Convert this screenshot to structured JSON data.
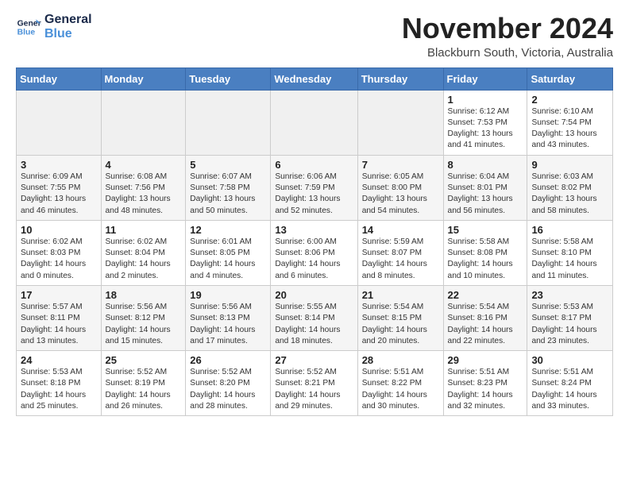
{
  "header": {
    "logo_line1": "General",
    "logo_line2": "Blue",
    "month": "November 2024",
    "location": "Blackburn South, Victoria, Australia"
  },
  "weekdays": [
    "Sunday",
    "Monday",
    "Tuesday",
    "Wednesday",
    "Thursday",
    "Friday",
    "Saturday"
  ],
  "weeks": [
    [
      {
        "day": "",
        "info": ""
      },
      {
        "day": "",
        "info": ""
      },
      {
        "day": "",
        "info": ""
      },
      {
        "day": "",
        "info": ""
      },
      {
        "day": "",
        "info": ""
      },
      {
        "day": "1",
        "info": "Sunrise: 6:12 AM\nSunset: 7:53 PM\nDaylight: 13 hours\nand 41 minutes."
      },
      {
        "day": "2",
        "info": "Sunrise: 6:10 AM\nSunset: 7:54 PM\nDaylight: 13 hours\nand 43 minutes."
      }
    ],
    [
      {
        "day": "3",
        "info": "Sunrise: 6:09 AM\nSunset: 7:55 PM\nDaylight: 13 hours\nand 46 minutes."
      },
      {
        "day": "4",
        "info": "Sunrise: 6:08 AM\nSunset: 7:56 PM\nDaylight: 13 hours\nand 48 minutes."
      },
      {
        "day": "5",
        "info": "Sunrise: 6:07 AM\nSunset: 7:58 PM\nDaylight: 13 hours\nand 50 minutes."
      },
      {
        "day": "6",
        "info": "Sunrise: 6:06 AM\nSunset: 7:59 PM\nDaylight: 13 hours\nand 52 minutes."
      },
      {
        "day": "7",
        "info": "Sunrise: 6:05 AM\nSunset: 8:00 PM\nDaylight: 13 hours\nand 54 minutes."
      },
      {
        "day": "8",
        "info": "Sunrise: 6:04 AM\nSunset: 8:01 PM\nDaylight: 13 hours\nand 56 minutes."
      },
      {
        "day": "9",
        "info": "Sunrise: 6:03 AM\nSunset: 8:02 PM\nDaylight: 13 hours\nand 58 minutes."
      }
    ],
    [
      {
        "day": "10",
        "info": "Sunrise: 6:02 AM\nSunset: 8:03 PM\nDaylight: 14 hours\nand 0 minutes."
      },
      {
        "day": "11",
        "info": "Sunrise: 6:02 AM\nSunset: 8:04 PM\nDaylight: 14 hours\nand 2 minutes."
      },
      {
        "day": "12",
        "info": "Sunrise: 6:01 AM\nSunset: 8:05 PM\nDaylight: 14 hours\nand 4 minutes."
      },
      {
        "day": "13",
        "info": "Sunrise: 6:00 AM\nSunset: 8:06 PM\nDaylight: 14 hours\nand 6 minutes."
      },
      {
        "day": "14",
        "info": "Sunrise: 5:59 AM\nSunset: 8:07 PM\nDaylight: 14 hours\nand 8 minutes."
      },
      {
        "day": "15",
        "info": "Sunrise: 5:58 AM\nSunset: 8:08 PM\nDaylight: 14 hours\nand 10 minutes."
      },
      {
        "day": "16",
        "info": "Sunrise: 5:58 AM\nSunset: 8:10 PM\nDaylight: 14 hours\nand 11 minutes."
      }
    ],
    [
      {
        "day": "17",
        "info": "Sunrise: 5:57 AM\nSunset: 8:11 PM\nDaylight: 14 hours\nand 13 minutes."
      },
      {
        "day": "18",
        "info": "Sunrise: 5:56 AM\nSunset: 8:12 PM\nDaylight: 14 hours\nand 15 minutes."
      },
      {
        "day": "19",
        "info": "Sunrise: 5:56 AM\nSunset: 8:13 PM\nDaylight: 14 hours\nand 17 minutes."
      },
      {
        "day": "20",
        "info": "Sunrise: 5:55 AM\nSunset: 8:14 PM\nDaylight: 14 hours\nand 18 minutes."
      },
      {
        "day": "21",
        "info": "Sunrise: 5:54 AM\nSunset: 8:15 PM\nDaylight: 14 hours\nand 20 minutes."
      },
      {
        "day": "22",
        "info": "Sunrise: 5:54 AM\nSunset: 8:16 PM\nDaylight: 14 hours\nand 22 minutes."
      },
      {
        "day": "23",
        "info": "Sunrise: 5:53 AM\nSunset: 8:17 PM\nDaylight: 14 hours\nand 23 minutes."
      }
    ],
    [
      {
        "day": "24",
        "info": "Sunrise: 5:53 AM\nSunset: 8:18 PM\nDaylight: 14 hours\nand 25 minutes."
      },
      {
        "day": "25",
        "info": "Sunrise: 5:52 AM\nSunset: 8:19 PM\nDaylight: 14 hours\nand 26 minutes."
      },
      {
        "day": "26",
        "info": "Sunrise: 5:52 AM\nSunset: 8:20 PM\nDaylight: 14 hours\nand 28 minutes."
      },
      {
        "day": "27",
        "info": "Sunrise: 5:52 AM\nSunset: 8:21 PM\nDaylight: 14 hours\nand 29 minutes."
      },
      {
        "day": "28",
        "info": "Sunrise: 5:51 AM\nSunset: 8:22 PM\nDaylight: 14 hours\nand 30 minutes."
      },
      {
        "day": "29",
        "info": "Sunrise: 5:51 AM\nSunset: 8:23 PM\nDaylight: 14 hours\nand 32 minutes."
      },
      {
        "day": "30",
        "info": "Sunrise: 5:51 AM\nSunset: 8:24 PM\nDaylight: 14 hours\nand 33 minutes."
      }
    ]
  ]
}
